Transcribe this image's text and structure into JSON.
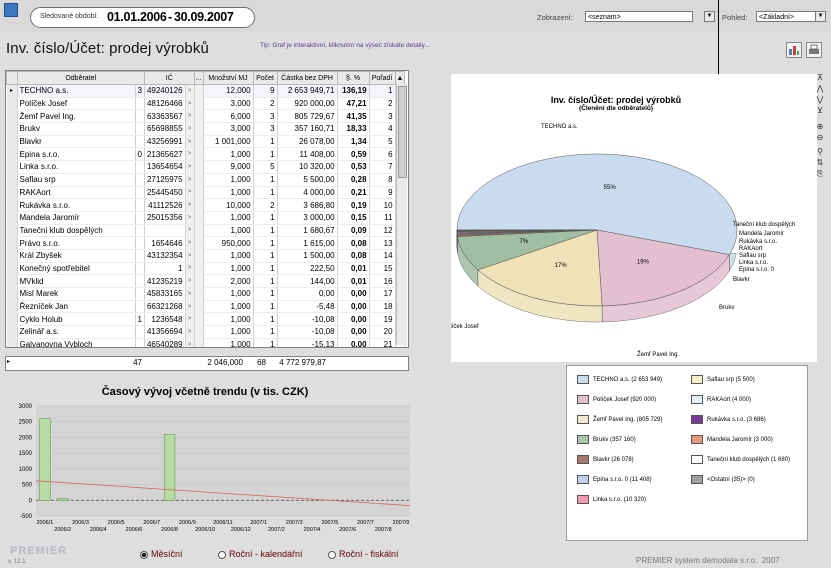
{
  "header": {
    "period_label": "Sledované období:",
    "period_from": "01.01.2006",
    "period_sep": "-",
    "period_to": "30.09.2007",
    "zobrazeni_label": "Zobrazení:",
    "zobrazeni_value": "<seznam>",
    "pohled_label": "Pohled:",
    "pohled_value": "<Základní>",
    "title": "Inv. číslo/Účet: prodej výrobků",
    "tip": "Tip: Graf je interaktivní, kliknutím na výseč získáte detaily..."
  },
  "grid": {
    "columns": [
      "Odběratel",
      "IČ",
      "...",
      "Množství MJ",
      "Počet",
      "Částka bez DPH",
      "§. %",
      "Pořadí"
    ],
    "rows": [
      [
        "TECHNO a.s.",
        "3",
        "49240126",
        "12,000",
        "9",
        "2 653 949,71",
        "136,19",
        "1"
      ],
      [
        "Políček Josef",
        "",
        "48126466",
        "3,000",
        "2",
        "920 000,00",
        "47,21",
        "2"
      ],
      [
        "Žemľ Pavel Ing.",
        "",
        "63363567",
        "6,000",
        "3",
        "805 729,67",
        "41,35",
        "3"
      ],
      [
        "Brukv",
        "",
        "65698855",
        "3,000",
        "3",
        "357 160,71",
        "18,33",
        "4"
      ],
      [
        "Blavkr",
        "",
        "43256991",
        "1 001,000",
        "1",
        "26 078,00",
        "1,34",
        "5"
      ],
      [
        "Epina s.r.o.",
        "0",
        "21365627",
        "1,000",
        "1",
        "11 408,00",
        "0,59",
        "6"
      ],
      [
        "Linka s.r.o.",
        "",
        "13654654",
        "9,000",
        "5",
        "10 320,00",
        "0,53",
        "7"
      ],
      [
        "Saflau srp",
        "",
        "27125975",
        "1,000",
        "1",
        "5 500,00",
        "0,28",
        "8"
      ],
      [
        "RAKAort",
        "",
        "25445450",
        "1,000",
        "1",
        "4 000,00",
        "0,21",
        "9"
      ],
      [
        "Rukávka s.r.o.",
        "",
        "41112526",
        "10,000",
        "2",
        "3 686,80",
        "0,19",
        "10"
      ],
      [
        "Mandela Jaromír",
        "",
        "25015356",
        "1,000",
        "1",
        "3 000,00",
        "0,15",
        "11"
      ],
      [
        "Taneční klub dospělých",
        "",
        "",
        "1,000",
        "1",
        "1 680,67",
        "0,09",
        "12"
      ],
      [
        "Právo s.r.o.",
        "",
        "1654646",
        "950,000",
        "1",
        "1 615,00",
        "0,08",
        "13"
      ],
      [
        "Král Zbyšek",
        "",
        "43132354",
        "1,000",
        "1",
        "1 500,00",
        "0,08",
        "14"
      ],
      [
        "Konečný spotřebitel",
        "",
        "1",
        "1,000",
        "1",
        "222,50",
        "0,01",
        "15"
      ],
      [
        "MVklid",
        "",
        "41235219",
        "2,000",
        "1",
        "144,00",
        "0,01",
        "16"
      ],
      [
        "Misl Marek",
        "",
        "45833165",
        "1,000",
        "1",
        "0,00",
        "0,00",
        "17"
      ],
      [
        "Řezníček Jan",
        "",
        "66321268",
        "1,000",
        "1",
        "-5,48",
        "0,00",
        "18"
      ],
      [
        "Cyklo Holub",
        "1",
        "1236548",
        "1,000",
        "1",
        "-10,08",
        "0,00",
        "19"
      ],
      [
        "Zelinář a.s.",
        "",
        "41356694",
        "1,000",
        "1",
        "-10,08",
        "0,00",
        "20"
      ],
      [
        "Galvanovna Vybloch",
        "",
        "46540289",
        "1,000",
        "1",
        "-15,13",
        "0,00",
        "21"
      ]
    ],
    "totals": {
      "count": "47",
      "mj": "2 046,000",
      "pocet": "68",
      "castka": "4 772 979,87"
    }
  },
  "trend": {
    "title": "Časový vývoj včetně trendu (v tis. CZK)",
    "yticks": [
      "3000",
      "2500",
      "2000",
      "1500",
      "1000",
      "500",
      "0",
      "-500"
    ],
    "xticks_top": [
      "2006/1",
      "2006/3",
      "2006/5",
      "2006/7",
      "2006/9",
      "2006/11",
      "2007/1",
      "2007/3",
      "2007/5",
      "2007/7",
      "2007/9"
    ],
    "xticks_bottom": [
      "2006/2",
      "2006/4",
      "2006/6",
      "2006/8",
      "2006/10",
      "2006/12",
      "2007/2",
      "2007/4",
      "2007/6",
      "2007/8"
    ],
    "radio_monthly": "Měsíční",
    "radio_calendar": "Roční - kalendářní",
    "radio_fiscal": "Roční - fiskální"
  },
  "chart_data": {
    "type": "bar",
    "title": "Časový vývoj včetně trendu (v tis. CZK)",
    "ylim": [
      -500,
      3000
    ],
    "categories": [
      "2006/1",
      "2006/2",
      "2006/3",
      "2006/4",
      "2006/5",
      "2006/6",
      "2006/7",
      "2006/8",
      "2006/9",
      "2006/10",
      "2006/11",
      "2006/12",
      "2007/1",
      "2007/2",
      "2007/3",
      "2007/4",
      "2007/5",
      "2007/6",
      "2007/7",
      "2007/8",
      "2007/9"
    ],
    "values": [
      2600,
      60,
      0,
      0,
      0,
      0,
      0,
      2100,
      0,
      0,
      0,
      0,
      0,
      0,
      0,
      0,
      0,
      0,
      0,
      0,
      0
    ],
    "trend": [
      620,
      -170
    ]
  },
  "pie": {
    "title": "Inv. číslo/Účet: prodej výrobků",
    "subtitle": "(Členění dle odběratelů)",
    "slices": [
      {
        "label": "TECHNO a.s.",
        "value": 2653949,
        "pct": "55%",
        "color": "#c9dbef"
      },
      {
        "label": "Políček Josef",
        "value": 920000,
        "pct": "19%",
        "color": "#e3bfcf"
      },
      {
        "label": "Žemľ Pavel Ing.",
        "value": 805729,
        "pct": "17%",
        "color": "#efe1b8"
      },
      {
        "label": "Brukv",
        "value": 357160,
        "pct": "7%",
        "color": "#9fbea2"
      },
      {
        "label": "Blavkr",
        "value": 26078,
        "pct": "",
        "color": "#8c6a5c"
      },
      {
        "label": "Epina s.r.o.      0",
        "value": 11408,
        "pct": "",
        "color": "#5c8fd0"
      },
      {
        "label": "Linka s.r.o.",
        "value": 10320,
        "pct": "",
        "color": "#ea7f9a"
      },
      {
        "label": "Saflau srp",
        "value": 5500,
        "pct": "",
        "color": "#f1e89a"
      },
      {
        "label": "RAKAort",
        "value": 4000,
        "pct": "",
        "color": "#a7c7ee"
      },
      {
        "label": "Rukávka s.r.o.",
        "value": 3686,
        "pct": "",
        "color": "#6a2a84"
      },
      {
        "label": "Mandela Jaromír",
        "value": 3000,
        "pct": "",
        "color": "#e39a76"
      },
      {
        "label": "Taneční klub dospělých",
        "value": 1680,
        "pct": "",
        "color": "#ffffff"
      }
    ],
    "legend": [
      [
        "TECHNO a.s. (2 653 949)",
        "#c9dbef"
      ],
      [
        "Saflau srp (5 500)",
        "#f6f0c0"
      ],
      [
        "Políček Josef (920 000)",
        "#e3bfcf"
      ],
      [
        "RAKAort (4 000)",
        "#e6eef8"
      ],
      [
        "Žemľ Pavel Ing. (805 729)",
        "#f4ead0"
      ],
      [
        "Rukávka s.r.o. (3 686)",
        "#7a3a94"
      ],
      [
        "Brukv (357 160)",
        "#a9c6ab"
      ],
      [
        "Mandela Jaromír (3 000)",
        "#e39a76"
      ],
      [
        "Blavkr (26 078)",
        "#a4786a"
      ],
      [
        "Taneční klub dospělých (1 680)",
        "#ffffff"
      ],
      [
        "Epina s.r.o.      0 (11 408)",
        "#bfd1ee"
      ],
      [
        "<Ostatní (35)> (0)",
        "#a0a0a0"
      ],
      [
        "Linka s.r.o. (10 320)",
        "#f09ab0"
      ]
    ]
  },
  "footer": {
    "company": "PREMIER system demodata s.r.o.",
    "year": "2007",
    "logo": "PREMIER",
    "version": "v. 12.1"
  }
}
